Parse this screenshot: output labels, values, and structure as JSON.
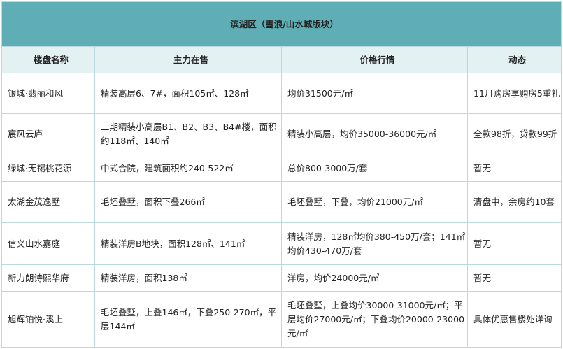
{
  "title": "滨湖区（雪浪/山水城版块）",
  "headers": [
    "楼盘名称",
    "主力在售",
    "价格行情",
    "动态"
  ],
  "rows": [
    {
      "name": "银城·翡丽和风",
      "sale": "精装高层6、7#，面积105㎡、128㎡",
      "price": "均价31500元/㎡",
      "news": "11月购房享购房5重礼"
    },
    {
      "name": "宸风云庐",
      "sale": "二期精装小高层B1、B2、B3、B4#楼，面积约118㎡、140㎡",
      "price": "精装小高层，均价35000-36000元/㎡",
      "news": "全款98折，贷款99折"
    },
    {
      "name": "绿城·无锡桃花源",
      "sale": "中式合院，建筑面积约240-522㎡",
      "price": "总价800-3000万/套",
      "news": "暂无"
    },
    {
      "name": "太湖金茂逸墅",
      "sale": "毛坯叠墅，面积下叠266㎡",
      "price": "毛坯叠墅，下叠，均价21000元/㎡",
      "news": "清盘中，余房约10套"
    },
    {
      "name": "信义山水嘉庭",
      "sale": "精装洋房B地块，面积128㎡、141㎡",
      "price": "精装洋房，128㎡均价380-450万/套；141㎡均价430-470万/套",
      "news": "暂无"
    },
    {
      "name": "新力朗诗熙华府",
      "sale": "精装洋房，面积138㎡",
      "price": "洋房，均价24000元/㎡",
      "news": "暂无"
    },
    {
      "name": "旭辉铂悦·溪上",
      "sale": "毛坯叠墅，上叠146㎡，下叠250-270㎡，平层144㎡",
      "price": "毛坯叠墅，上叠均价30000-31000元/㎡；平层均价27000元/㎡；下叠均价20000-23000元/㎡",
      "news": "具体优惠售楼处详询"
    }
  ]
}
